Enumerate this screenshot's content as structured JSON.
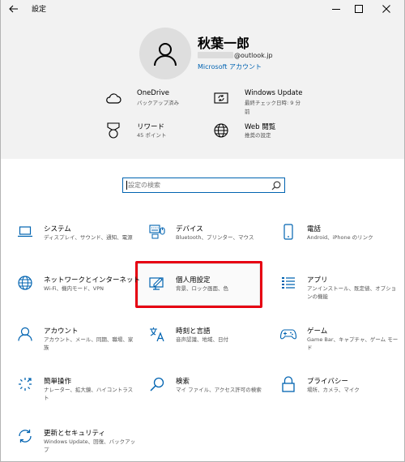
{
  "window": {
    "title": "設定"
  },
  "profile": {
    "name": "秋葉一郎",
    "email_domain": "@outlook.jp",
    "account_link": "Microsoft アカウント"
  },
  "header_items": [
    {
      "id": "onedrive",
      "title": "OneDrive",
      "sub": "バックアップ済み",
      "icon": "cloud-icon"
    },
    {
      "id": "windows-update",
      "title": "Windows Update",
      "sub": "最終チェック日時: 9 分",
      "sub2": "前",
      "icon": "update-icon"
    },
    {
      "id": "rewards",
      "title": "リワード",
      "sub": "45 ポイント",
      "icon": "medal-icon"
    },
    {
      "id": "web-browsing",
      "title": "Web 閲覧",
      "sub": "推奨の設定",
      "icon": "globe-icon"
    }
  ],
  "search": {
    "placeholder": "設定の検索"
  },
  "categories": [
    {
      "title": "システム",
      "desc": "ディスプレイ、サウンド、通知、電源",
      "icon": "laptop-icon"
    },
    {
      "title": "デバイス",
      "desc": "Bluetooth、プリンター、マウス",
      "icon": "keyboard-icon"
    },
    {
      "title": "電話",
      "desc": "Android、iPhone のリンク",
      "icon": "phone-icon"
    },
    {
      "title": "ネットワークとインターネット",
      "desc": "Wi-Fi、機内モード、VPN",
      "icon": "globe-icon"
    },
    {
      "title": "個人用設定",
      "desc": "背景、ロック画面、色",
      "icon": "personalize-icon"
    },
    {
      "title": "アプリ",
      "desc": "アンインストール、既定値、オプションの機能",
      "icon": "apps-list-icon"
    },
    {
      "title": "アカウント",
      "desc": "アカウント、メール、同期、職場、家族",
      "icon": "person-icon"
    },
    {
      "title": "時刻と言語",
      "desc": "音声認識、地域、日付",
      "icon": "language-icon"
    },
    {
      "title": "ゲーム",
      "desc": "Game Bar、キャプチャ、ゲーム モード",
      "icon": "gamepad-icon"
    },
    {
      "title": "簡単操作",
      "desc": "ナレーター、拡大鏡、ハイコントラスト",
      "icon": "ease-of-access-icon"
    },
    {
      "title": "検索",
      "desc": "マイ ファイル、アクセス許可の検索",
      "icon": "search-icon"
    },
    {
      "title": "プライバシー",
      "desc": "場所、カメラ、マイク",
      "icon": "lock-icon"
    },
    {
      "title": "更新とセキュリティ",
      "desc": "Windows Update、回復、バックアップ",
      "icon": "sync-icon"
    }
  ],
  "colors": {
    "accent": "#0063b1",
    "highlight": "#e60012",
    "header_bg": "#f2f2f2"
  }
}
